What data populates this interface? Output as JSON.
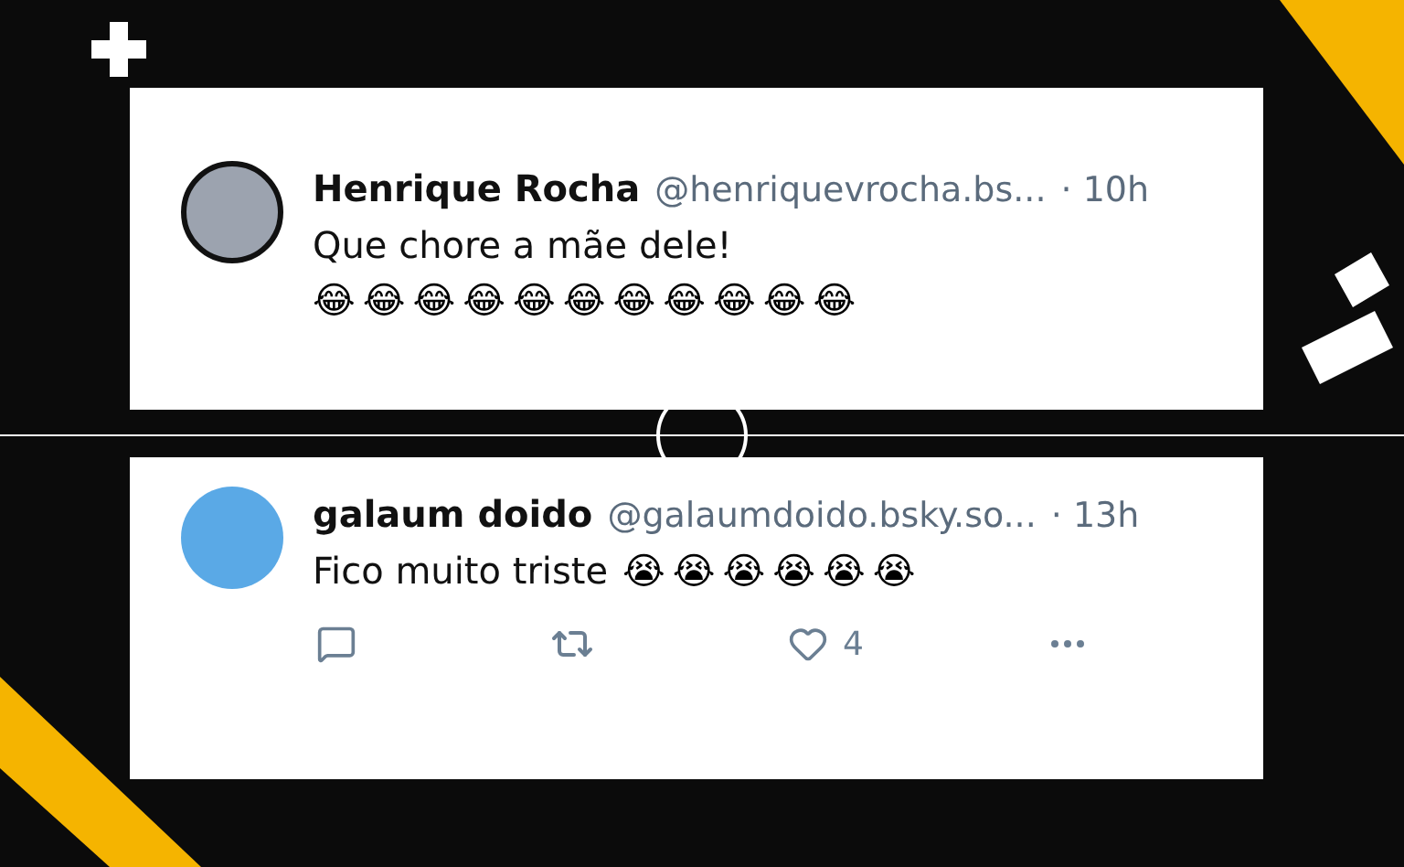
{
  "posts": [
    {
      "name": "Henrique Rocha",
      "handle": "@henriquevrocha.bs...",
      "time": "· 10h",
      "text": "Que chore a mãe dele!",
      "emojis": "😂😂😂😂😂😂😂😂😂😂😂"
    },
    {
      "name": "galaum doido",
      "handle": "@galaumdoido.bsky.so...",
      "time": "· 13h",
      "text": "Fico muito triste",
      "emojis": "😭😭😭😭😭😭",
      "actions": {
        "likes": "4"
      }
    }
  ]
}
